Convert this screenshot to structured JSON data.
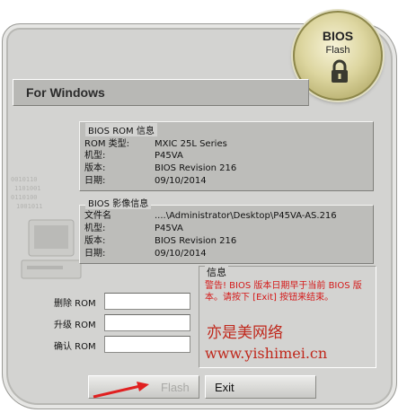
{
  "badge": {
    "title": "BIOS",
    "subtitle": "Flash"
  },
  "title_bar": {
    "text": "For Windows"
  },
  "rom_info": {
    "section_title": "BIOS ROM 信息",
    "rows": [
      {
        "label": "ROM 类型:",
        "value": "MXIC 25L Series"
      },
      {
        "label": "机型:",
        "value": "P45VA"
      },
      {
        "label": "版本:",
        "value": "BIOS Revision 216"
      },
      {
        "label": "日期:",
        "value": "09/10/2014"
      }
    ]
  },
  "image_info": {
    "section_title": "BIOS 影像信息",
    "rows": [
      {
        "label": "文件名",
        "value": "....\\Administrator\\Desktop\\P45VA-AS.216"
      },
      {
        "label": "机型:",
        "value": "P45VA"
      },
      {
        "label": "版本:",
        "value": "BIOS Revision 216"
      },
      {
        "label": "日期:",
        "value": "09/10/2014"
      }
    ]
  },
  "rom_fields": [
    {
      "label": "删除 ROM",
      "value": ""
    },
    {
      "label": "升级 ROM",
      "value": ""
    },
    {
      "label": "确认 ROM",
      "value": ""
    }
  ],
  "info": {
    "legend": "信息",
    "warning": "警告! BIOS 版本日期早于当前 BIOS 版本。请按下 [Exit] 按钮来结束。"
  },
  "watermark": {
    "line1": "亦是美网络",
    "line2": "www.yishimei.cn"
  },
  "buttons": {
    "flash": "Flash",
    "exit": "Exit"
  },
  "colors": {
    "warning": "#d41818",
    "window": "#d3d3d1",
    "badge_gold": "#ddd6a0",
    "arrow": "#e02020"
  }
}
